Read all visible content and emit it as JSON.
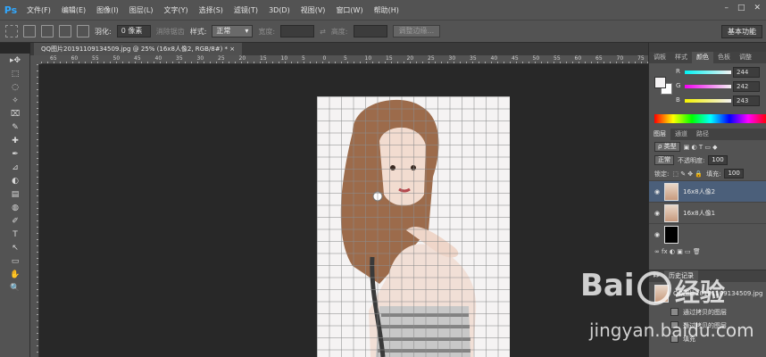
{
  "app": {
    "logo": "Ps"
  },
  "menu": {
    "items": [
      "文件(F)",
      "编辑(E)",
      "图像(I)",
      "图层(L)",
      "文字(Y)",
      "选择(S)",
      "滤镜(T)",
      "3D(D)",
      "视图(V)",
      "窗口(W)",
      "帮助(H)"
    ]
  },
  "window_controls": [
    "–",
    "□",
    "✕"
  ],
  "options_bar": {
    "feather_label": "羽化:",
    "feather_value": "0 像素",
    "antialias_label": "消除锯齿",
    "style_label": "样式:",
    "style_value": "正常",
    "width_label": "宽度:",
    "height_label": "高度:",
    "refine_button": "调整边缘...",
    "workspace": "基本功能"
  },
  "document_tab": {
    "title": "QQ图片20191109134509.jpg @ 25% (16x8人像2, RGB/8#) * ×"
  },
  "ruler": {
    "numbers": [
      "65",
      "60",
      "55",
      "50",
      "45",
      "40",
      "35",
      "30",
      "25",
      "20",
      "15",
      "10",
      "5",
      "0",
      "5",
      "10",
      "15",
      "20",
      "25",
      "30",
      "35",
      "40",
      "45",
      "50",
      "55",
      "60",
      "65",
      "70",
      "75"
    ]
  },
  "tools": [
    "▸✥",
    "⬚",
    "◌",
    "✧",
    "⌧",
    "✎",
    "✚",
    "✒",
    "⊿",
    "◐",
    "▤",
    "◍",
    "✐",
    "T",
    "↖",
    "▭",
    "✋",
    "🔍"
  ],
  "color_panel": {
    "tabs": [
      "调板",
      "样式",
      "颜色",
      "色板",
      "调整"
    ],
    "active_tab": "颜色",
    "channels": [
      {
        "letter": "R",
        "value": "244",
        "gradient": "linear-gradient(to right,#00f2f3,#f4f2f3)"
      },
      {
        "letter": "G",
        "value": "242",
        "gradient": "linear-gradient(to right,#f400f3,#f4f2f3)"
      },
      {
        "letter": "B",
        "value": "243",
        "gradient": "linear-gradient(to right,#f4f200,#f4f2f3)"
      }
    ]
  },
  "layers_panel": {
    "tabs": [
      "图层",
      "通道",
      "路径"
    ],
    "kind_filter": "ρ 类型",
    "blend_mode": "正常",
    "opacity_label": "不透明度:",
    "opacity_value": "100",
    "lock_label": "锁定:",
    "fill_label": "填充:",
    "fill_value": "100",
    "layers": [
      {
        "name": "16x8人像2",
        "selected": true
      },
      {
        "name": "16x8人像1",
        "selected": false
      },
      {
        "name": "",
        "selected": false
      }
    ]
  },
  "history_panel": {
    "tabs": [
      "历史记录"
    ],
    "snapshot": "QQ图片20191109134509.jpg",
    "states": [
      "通过拷贝的图层",
      "通过拷贝的图层",
      "填充"
    ]
  },
  "watermark": {
    "logo": "Bai",
    "brand_cn": "经验",
    "url": "jingyan.baidu.com"
  }
}
